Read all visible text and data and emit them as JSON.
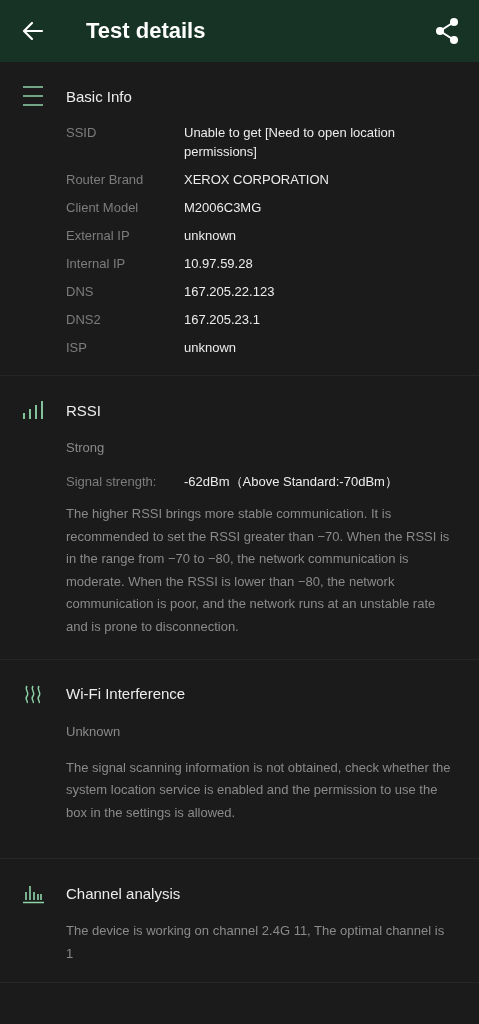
{
  "app_bar": {
    "title": "Test details"
  },
  "sections": [
    {
      "kind": "info",
      "title": "Basic Info",
      "rows": [
        {
          "label": "SSID",
          "value": "Unable to get [Need to open location permissions]"
        },
        {
          "label": "Router Brand",
          "value": "XEROX CORPORATION"
        },
        {
          "label": "Client Model",
          "value": "M2006C3MG"
        },
        {
          "label": "External IP",
          "value": "unknown"
        },
        {
          "label": "Internal IP",
          "value": "10.97.59.28"
        },
        {
          "label": "DNS",
          "value": "167.205.22.123"
        },
        {
          "label": "DNS2",
          "value": "167.205.23.1"
        },
        {
          "label": "ISP",
          "value": "unknown"
        }
      ]
    },
    {
      "kind": "signal",
      "title": "RSSI",
      "status": "Strong",
      "reading_label": "Signal strength:",
      "reading": "-62dBm（Above Standard:-70dBm）",
      "note": "The higher RSSI brings more stable communication. It is recommended to set the RSSI greater than −70. When the RSSI is in the range from −70 to −80, the network communication is moderate. When the RSSI is lower than −80, the network communication is poor, and the network runs at an unstable rate and is prone to disconnection."
    },
    {
      "kind": "interference",
      "title": "Wi-Fi Interference",
      "status": "Unknown",
      "note": "The signal scanning information is not obtained, check whether the system location service is enabled and the permission to use the box in the settings is allowed."
    },
    {
      "kind": "channel",
      "title": "Channel analysis",
      "note": "The device is working on channel 2.4G 11, The optimal channel is 1"
    }
  ]
}
